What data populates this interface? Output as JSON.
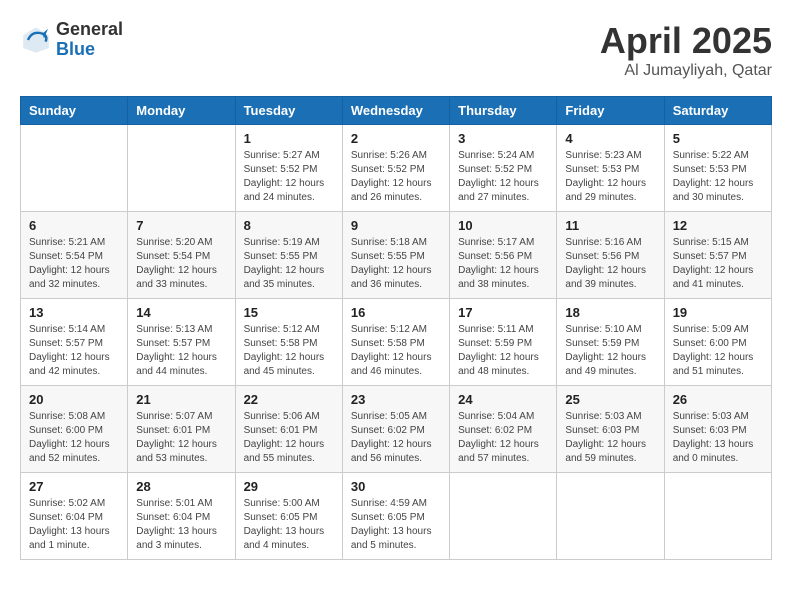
{
  "logo": {
    "general": "General",
    "blue": "Blue"
  },
  "title": "April 2025",
  "subtitle": "Al Jumayliyah, Qatar",
  "days_of_week": [
    "Sunday",
    "Monday",
    "Tuesday",
    "Wednesday",
    "Thursday",
    "Friday",
    "Saturday"
  ],
  "weeks": [
    [
      {
        "day": null
      },
      {
        "day": null
      },
      {
        "day": 1,
        "sunrise": "5:27 AM",
        "sunset": "5:52 PM",
        "daylight": "12 hours and 24 minutes."
      },
      {
        "day": 2,
        "sunrise": "5:26 AM",
        "sunset": "5:52 PM",
        "daylight": "12 hours and 26 minutes."
      },
      {
        "day": 3,
        "sunrise": "5:24 AM",
        "sunset": "5:52 PM",
        "daylight": "12 hours and 27 minutes."
      },
      {
        "day": 4,
        "sunrise": "5:23 AM",
        "sunset": "5:53 PM",
        "daylight": "12 hours and 29 minutes."
      },
      {
        "day": 5,
        "sunrise": "5:22 AM",
        "sunset": "5:53 PM",
        "daylight": "12 hours and 30 minutes."
      }
    ],
    [
      {
        "day": 6,
        "sunrise": "5:21 AM",
        "sunset": "5:54 PM",
        "daylight": "12 hours and 32 minutes."
      },
      {
        "day": 7,
        "sunrise": "5:20 AM",
        "sunset": "5:54 PM",
        "daylight": "12 hours and 33 minutes."
      },
      {
        "day": 8,
        "sunrise": "5:19 AM",
        "sunset": "5:55 PM",
        "daylight": "12 hours and 35 minutes."
      },
      {
        "day": 9,
        "sunrise": "5:18 AM",
        "sunset": "5:55 PM",
        "daylight": "12 hours and 36 minutes."
      },
      {
        "day": 10,
        "sunrise": "5:17 AM",
        "sunset": "5:56 PM",
        "daylight": "12 hours and 38 minutes."
      },
      {
        "day": 11,
        "sunrise": "5:16 AM",
        "sunset": "5:56 PM",
        "daylight": "12 hours and 39 minutes."
      },
      {
        "day": 12,
        "sunrise": "5:15 AM",
        "sunset": "5:57 PM",
        "daylight": "12 hours and 41 minutes."
      }
    ],
    [
      {
        "day": 13,
        "sunrise": "5:14 AM",
        "sunset": "5:57 PM",
        "daylight": "12 hours and 42 minutes."
      },
      {
        "day": 14,
        "sunrise": "5:13 AM",
        "sunset": "5:57 PM",
        "daylight": "12 hours and 44 minutes."
      },
      {
        "day": 15,
        "sunrise": "5:12 AM",
        "sunset": "5:58 PM",
        "daylight": "12 hours and 45 minutes."
      },
      {
        "day": 16,
        "sunrise": "5:12 AM",
        "sunset": "5:58 PM",
        "daylight": "12 hours and 46 minutes."
      },
      {
        "day": 17,
        "sunrise": "5:11 AM",
        "sunset": "5:59 PM",
        "daylight": "12 hours and 48 minutes."
      },
      {
        "day": 18,
        "sunrise": "5:10 AM",
        "sunset": "5:59 PM",
        "daylight": "12 hours and 49 minutes."
      },
      {
        "day": 19,
        "sunrise": "5:09 AM",
        "sunset": "6:00 PM",
        "daylight": "12 hours and 51 minutes."
      }
    ],
    [
      {
        "day": 20,
        "sunrise": "5:08 AM",
        "sunset": "6:00 PM",
        "daylight": "12 hours and 52 minutes."
      },
      {
        "day": 21,
        "sunrise": "5:07 AM",
        "sunset": "6:01 PM",
        "daylight": "12 hours and 53 minutes."
      },
      {
        "day": 22,
        "sunrise": "5:06 AM",
        "sunset": "6:01 PM",
        "daylight": "12 hours and 55 minutes."
      },
      {
        "day": 23,
        "sunrise": "5:05 AM",
        "sunset": "6:02 PM",
        "daylight": "12 hours and 56 minutes."
      },
      {
        "day": 24,
        "sunrise": "5:04 AM",
        "sunset": "6:02 PM",
        "daylight": "12 hours and 57 minutes."
      },
      {
        "day": 25,
        "sunrise": "5:03 AM",
        "sunset": "6:03 PM",
        "daylight": "12 hours and 59 minutes."
      },
      {
        "day": 26,
        "sunrise": "5:03 AM",
        "sunset": "6:03 PM",
        "daylight": "13 hours and 0 minutes."
      }
    ],
    [
      {
        "day": 27,
        "sunrise": "5:02 AM",
        "sunset": "6:04 PM",
        "daylight": "13 hours and 1 minute."
      },
      {
        "day": 28,
        "sunrise": "5:01 AM",
        "sunset": "6:04 PM",
        "daylight": "13 hours and 3 minutes."
      },
      {
        "day": 29,
        "sunrise": "5:00 AM",
        "sunset": "6:05 PM",
        "daylight": "13 hours and 4 minutes."
      },
      {
        "day": 30,
        "sunrise": "4:59 AM",
        "sunset": "6:05 PM",
        "daylight": "13 hours and 5 minutes."
      },
      {
        "day": null
      },
      {
        "day": null
      },
      {
        "day": null
      }
    ]
  ],
  "labels": {
    "sunrise": "Sunrise:",
    "sunset": "Sunset:",
    "daylight": "Daylight:"
  }
}
